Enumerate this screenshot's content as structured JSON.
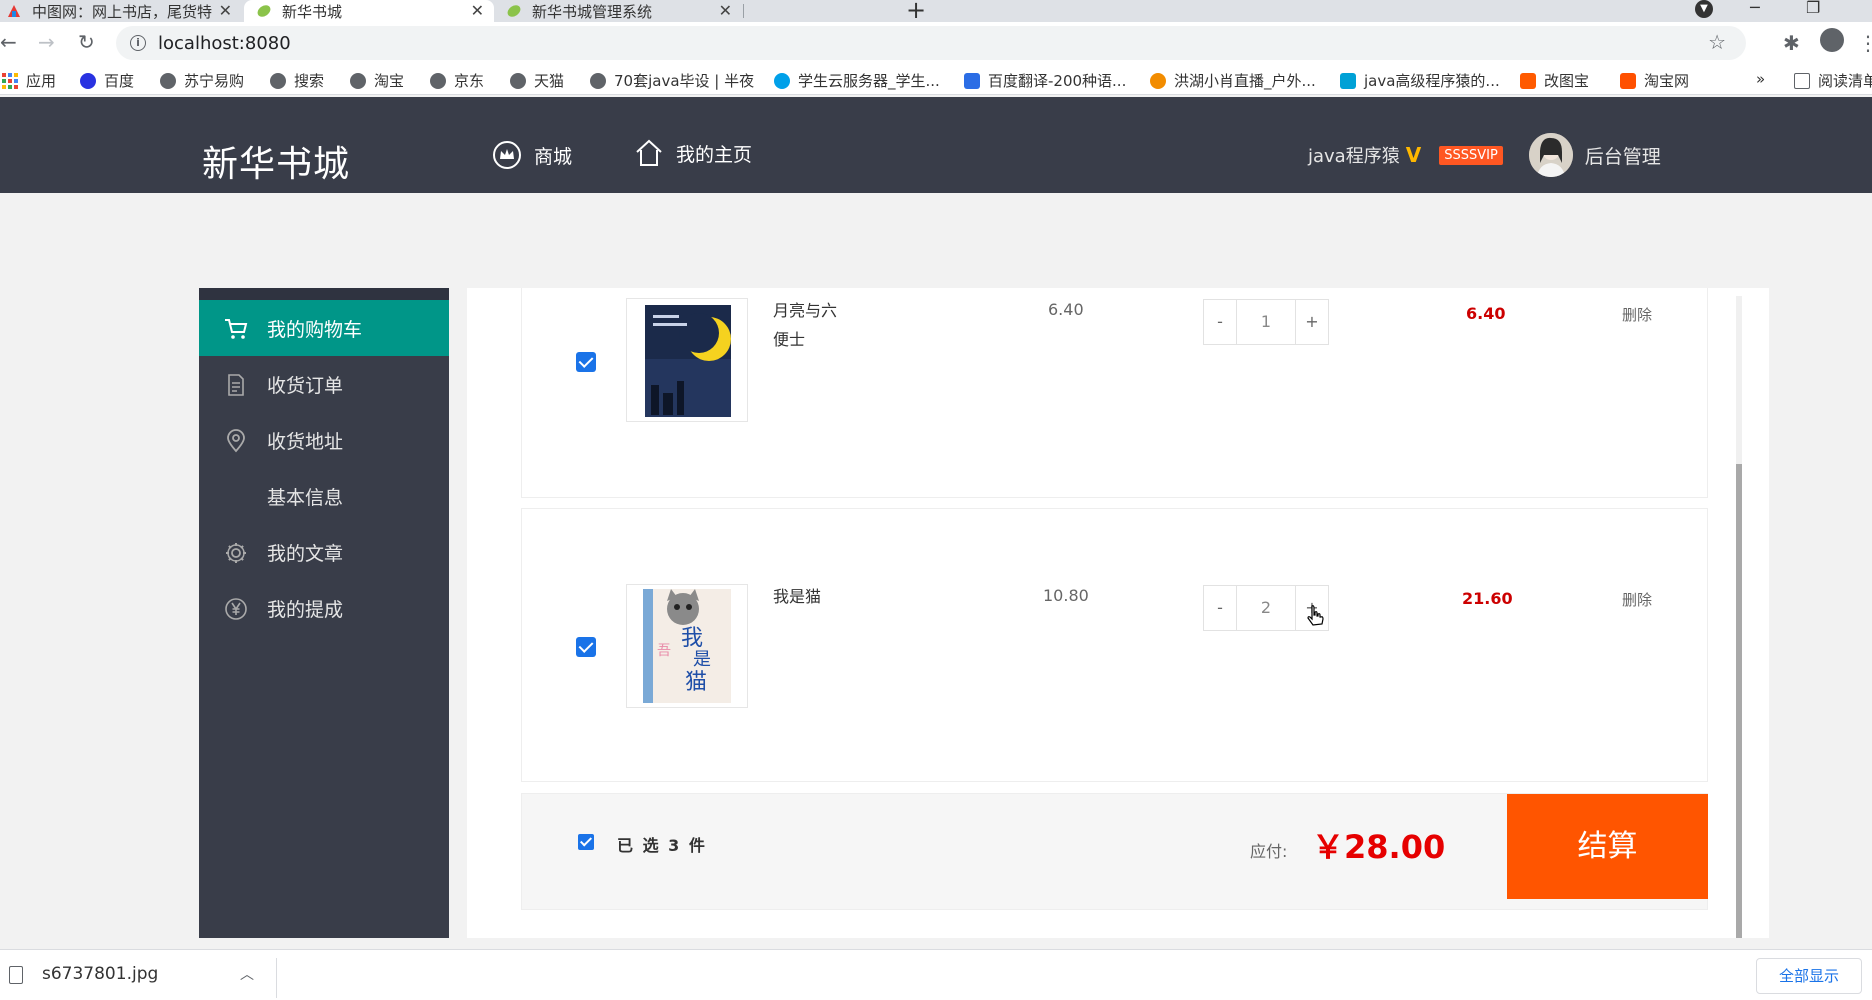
{
  "browser": {
    "tabs": [
      {
        "label": "中图网：网上书店，尾货特色书店",
        "icon": "zhongtu-favicon"
      },
      {
        "label": "新华书城",
        "icon": "leaf-favicon"
      },
      {
        "label": "新华书城管理系统",
        "icon": "leaf-favicon"
      }
    ],
    "new_tab": "+",
    "url": "localhost:8080",
    "bookmarks": [
      {
        "label": "应用",
        "icon": "apps-grid-icon",
        "color": "#4285f4"
      },
      {
        "label": "百度",
        "icon": "baidu-paw-icon",
        "color": "#2932e1"
      },
      {
        "label": "苏宁易购",
        "icon": "globe-icon",
        "color": "#5f6368"
      },
      {
        "label": "搜索",
        "icon": "globe-icon",
        "color": "#5f6368"
      },
      {
        "label": "淘宝",
        "icon": "globe-icon",
        "color": "#5f6368"
      },
      {
        "label": "京东",
        "icon": "globe-icon",
        "color": "#5f6368"
      },
      {
        "label": "天猫",
        "icon": "globe-icon",
        "color": "#5f6368"
      },
      {
        "label": "70套java毕设 | 半夜",
        "icon": "globe-icon",
        "color": "#5f6368"
      },
      {
        "label": "学生云服务器_学生...",
        "icon": "cloud-icon",
        "color": "#00a0e9"
      },
      {
        "label": "百度翻译-200种语...",
        "icon": "translate-icon",
        "color": "#2b6de5"
      },
      {
        "label": "洪湖小肖直播_户外...",
        "icon": "douyu-icon",
        "color": "#f28c00"
      },
      {
        "label": "java高级程序猿的...",
        "icon": "bilibili-icon",
        "color": "#00a1d6"
      },
      {
        "label": "改图宝",
        "icon": "gaitubao-icon",
        "color": "#ff5a00"
      },
      {
        "label": "淘宝网",
        "icon": "taobao-icon",
        "color": "#ff5000"
      }
    ],
    "more_bookmarks": "»",
    "reading_list": "阅读清单",
    "download": {
      "file": "s6737801.jpg",
      "show_all": "全部显示"
    }
  },
  "header": {
    "logo": "新华书城",
    "nav": [
      {
        "label": "商城",
        "icon": "crown-icon"
      },
      {
        "label": "我的主页",
        "icon": "home-icon"
      }
    ],
    "username": "java程序猿",
    "verified": "V",
    "vip_badge": "SSSSVIP",
    "admin_link": "后台管理"
  },
  "sidebar": {
    "items": [
      {
        "label": "我的购物车",
        "icon": "cart-icon",
        "active": true
      },
      {
        "label": "收货订单",
        "icon": "document-icon",
        "active": false
      },
      {
        "label": "收货地址",
        "icon": "location-icon",
        "active": false
      },
      {
        "label": "基本信息",
        "icon": "",
        "active": false
      },
      {
        "label": "我的文章",
        "icon": "gear-icon",
        "active": false
      },
      {
        "label": "我的提成",
        "icon": "yen-icon",
        "active": false
      }
    ]
  },
  "cart": {
    "items": [
      {
        "title": "月亮与六便士",
        "price": "6.40",
        "qty": "1",
        "subtotal": "6.40",
        "delete": "删除",
        "checked": true
      },
      {
        "title": "我是猫",
        "price": "10.80",
        "qty": "2",
        "subtotal": "21.60",
        "delete": "删除",
        "checked": true
      }
    ],
    "minus_label": "-",
    "plus_label": "+",
    "footer": {
      "selected_text": "已 选 3 件",
      "pay_label": "应付:",
      "total": "￥28.00",
      "checkout_label": "结算"
    }
  },
  "colors": {
    "header_bg": "#393d49",
    "sidebar_active": "#009688",
    "checkout": "#ff5500",
    "price_red": "#e60000",
    "vip_badge": "#ff5722"
  }
}
